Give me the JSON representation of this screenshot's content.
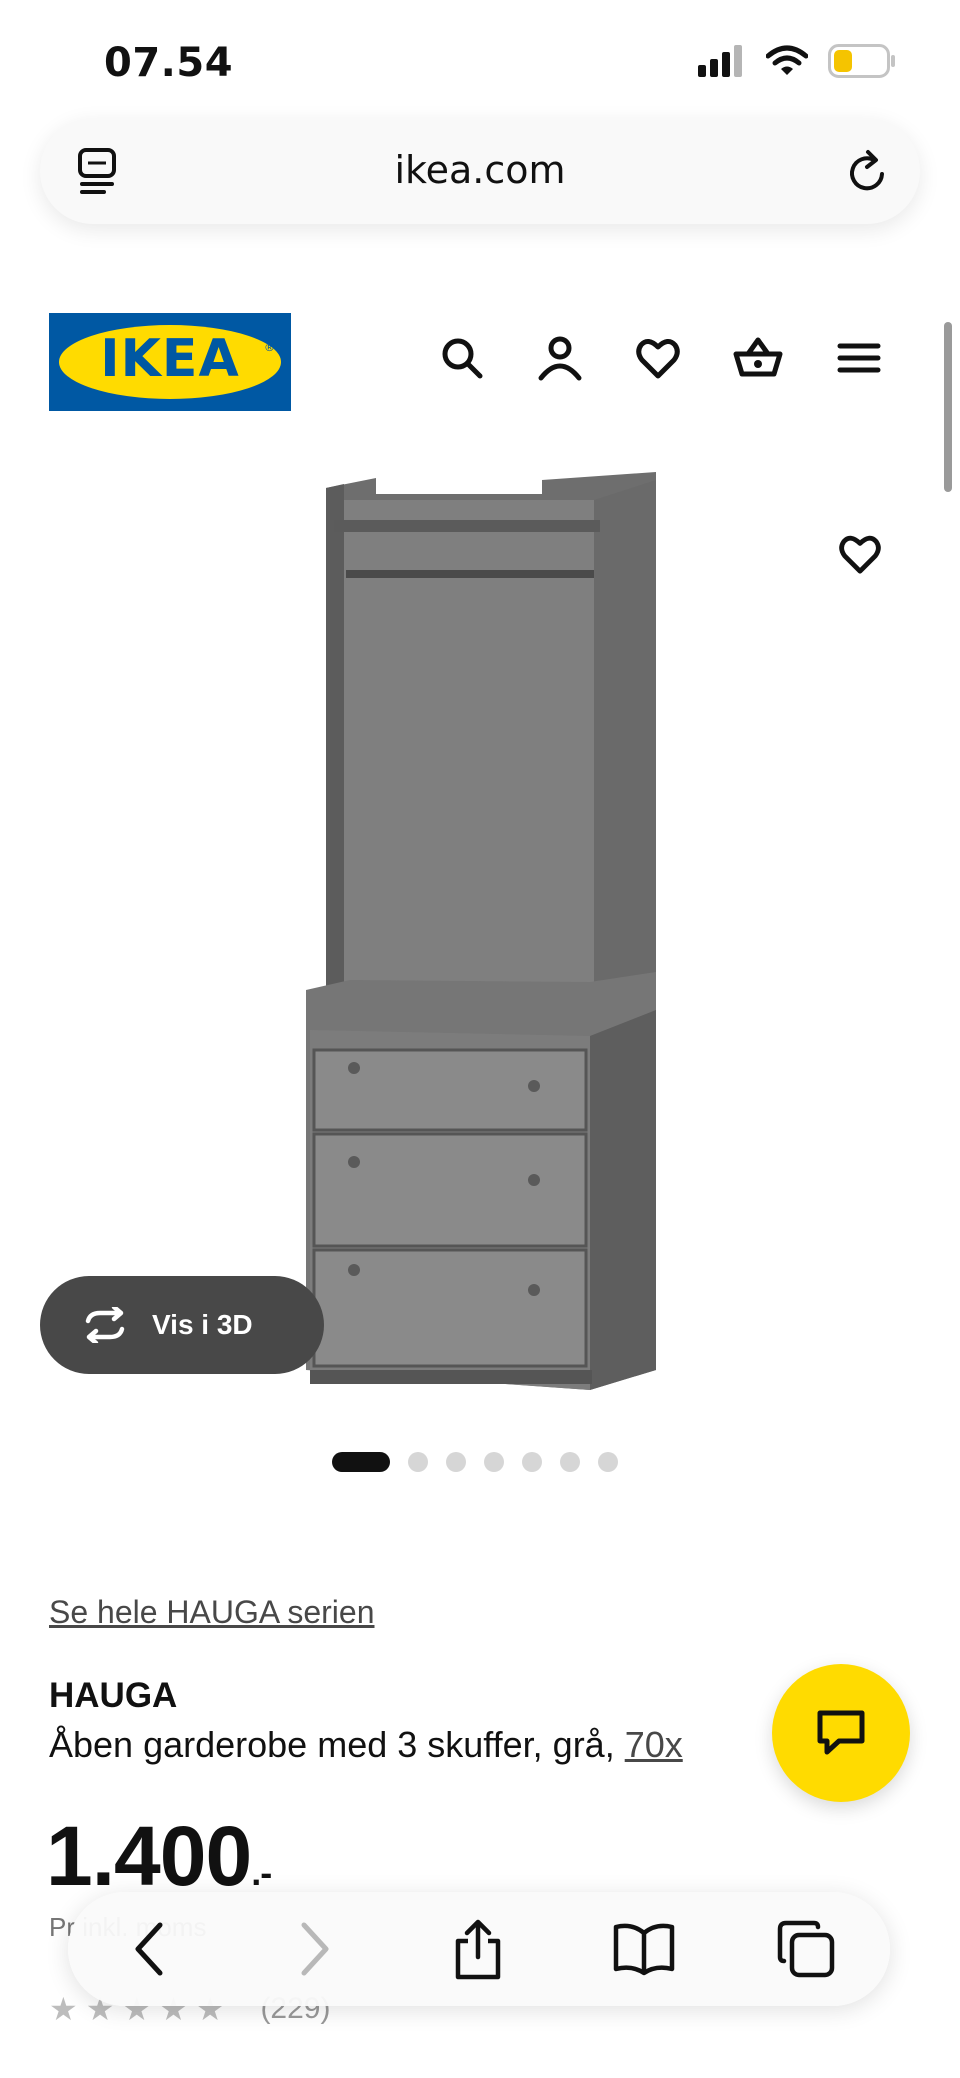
{
  "status_bar": {
    "time": "07.54"
  },
  "browser": {
    "url": "ikea.com"
  },
  "site": {
    "logo_text": "IKEA",
    "brand_blue": "#0058a3",
    "brand_yellow": "#ffdb00"
  },
  "gallery": {
    "vis3d_label": "Vis i 3D",
    "image_count": 7,
    "active_image": 1
  },
  "product": {
    "series_link": "Se hele HAUGA serien",
    "name": "HAUGA",
    "description": "Åben garderobe med 3 skuffer, grå, ",
    "dimension_link": "70x",
    "price_main": "1.400",
    "price_suffix": ".-",
    "vat_note": "Pr  inkl. moms",
    "rating_count": "(229)"
  },
  "icons": {
    "header": [
      "search-icon",
      "account-icon",
      "heart-icon",
      "basket-icon",
      "menu-icon"
    ],
    "toolbar": [
      "back-icon",
      "forward-icon",
      "share-icon",
      "bookmarks-icon",
      "tabs-icon"
    ]
  }
}
